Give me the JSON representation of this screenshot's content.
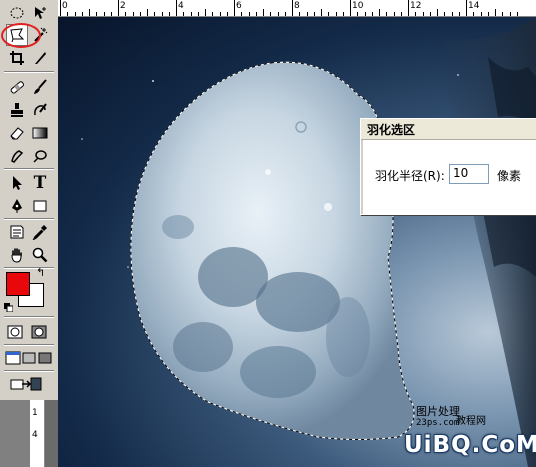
{
  "ruler": {
    "top_labels": [
      "0",
      "2",
      "4",
      "6",
      "8",
      "10",
      "12",
      "14"
    ],
    "left_labels": [
      "1",
      "4"
    ]
  },
  "toolbox": {
    "tools": [
      {
        "name": "marquee-tool",
        "icon": "marquee-icon"
      },
      {
        "name": "move-tool",
        "icon": "move-icon"
      },
      {
        "name": "lasso-tool",
        "icon": "polygonal-lasso-icon",
        "selected": true
      },
      {
        "name": "magic-wand-tool",
        "icon": "magic-wand-icon"
      },
      {
        "name": "crop-tool",
        "icon": "crop-icon"
      },
      {
        "name": "slice-tool",
        "icon": "slice-icon"
      },
      {
        "name": "healing-brush-tool",
        "icon": "bandage-icon"
      },
      {
        "name": "brush-tool",
        "icon": "brush-icon"
      },
      {
        "name": "stamp-tool",
        "icon": "stamp-icon"
      },
      {
        "name": "history-brush-tool",
        "icon": "history-brush-icon"
      },
      {
        "name": "eraser-tool",
        "icon": "eraser-icon"
      },
      {
        "name": "gradient-tool",
        "icon": "gradient-icon"
      },
      {
        "name": "smudge-tool",
        "icon": "smudge-icon"
      },
      {
        "name": "dodge-tool",
        "icon": "dodge-icon"
      },
      {
        "name": "path-select-tool",
        "icon": "arrow-icon"
      },
      {
        "name": "type-tool",
        "icon": "type-icon",
        "glyph": "T"
      },
      {
        "name": "pen-tool",
        "icon": "pen-icon"
      },
      {
        "name": "shape-tool",
        "icon": "rectangle-icon"
      },
      {
        "name": "notes-tool",
        "icon": "notes-icon"
      },
      {
        "name": "eyedropper-tool",
        "icon": "eyedropper-icon"
      },
      {
        "name": "hand-tool",
        "icon": "hand-icon"
      },
      {
        "name": "zoom-tool",
        "icon": "zoom-icon"
      }
    ],
    "foreground_color": "#e8080c",
    "background_color": "#ffffff",
    "highlight_color": "#e02020"
  },
  "dialog": {
    "title": "羽化选区",
    "label": "羽化半径(R):",
    "value": "10",
    "unit": "像素"
  },
  "watermark": {
    "line1": "图片处理",
    "line2": "23ps.com",
    "line3": "教程网",
    "logo": "UiBQ.CoM"
  }
}
